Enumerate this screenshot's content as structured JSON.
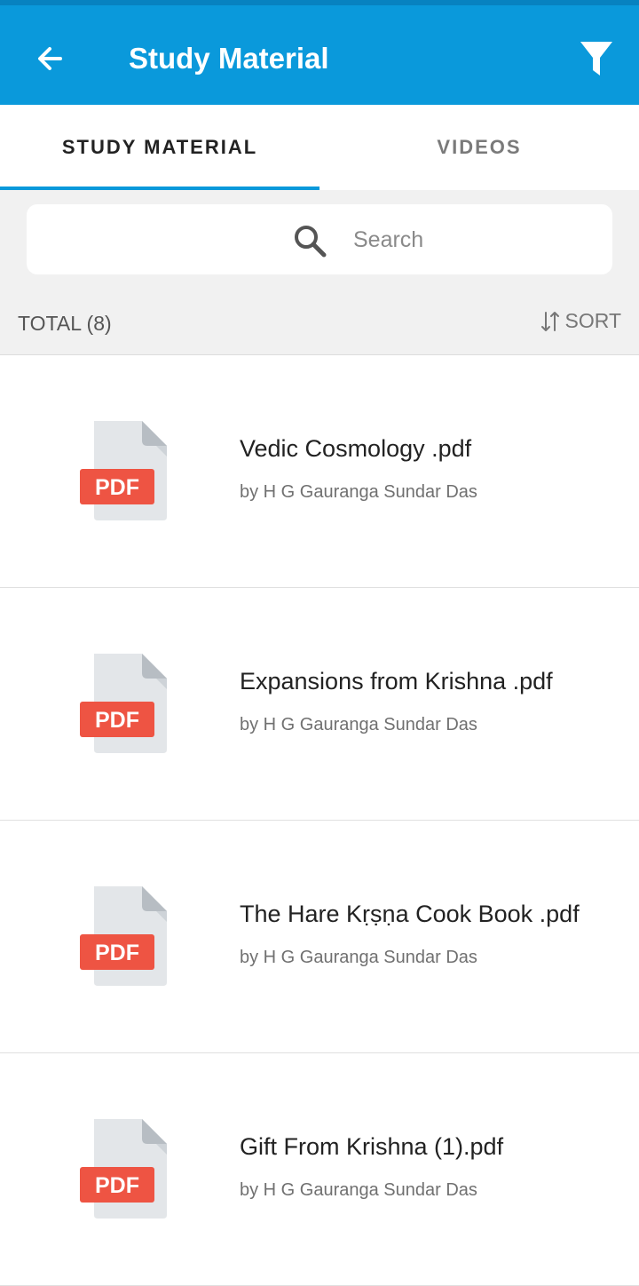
{
  "appbar": {
    "title": "Study Material",
    "back_icon": "arrow-left-icon",
    "filter_icon": "filter-funnel-icon",
    "color": "#0a99db"
  },
  "tabs": [
    {
      "label": "STUDY MATERIAL",
      "active": true
    },
    {
      "label": "VIDEOS",
      "active": false
    }
  ],
  "search": {
    "placeholder": "Search",
    "icon": "search-icon"
  },
  "summary": {
    "total_label": "TOTAL (8)",
    "sort_label": "SORT",
    "sort_icon": "sort-arrows-icon"
  },
  "items": [
    {
      "title": "Vedic Cosmology .pdf",
      "author": "by H G Gauranga Sundar Das",
      "badge": "PDF"
    },
    {
      "title": "Expansions from Krishna .pdf",
      "author": "by H G Gauranga Sundar Das",
      "badge": "PDF"
    },
    {
      "title": "The Hare Kṛṣṇa Cook Book .pdf",
      "author": "by H G Gauranga Sundar Das",
      "badge": "PDF"
    },
    {
      "title": "Gift From Krishna (1).pdf",
      "author": "by H G Gauranga Sundar Das",
      "badge": "PDF"
    }
  ],
  "colors": {
    "accent": "#0a99db",
    "pdf_badge": "#ee5443",
    "pdf_page": "#e3e6e9"
  }
}
